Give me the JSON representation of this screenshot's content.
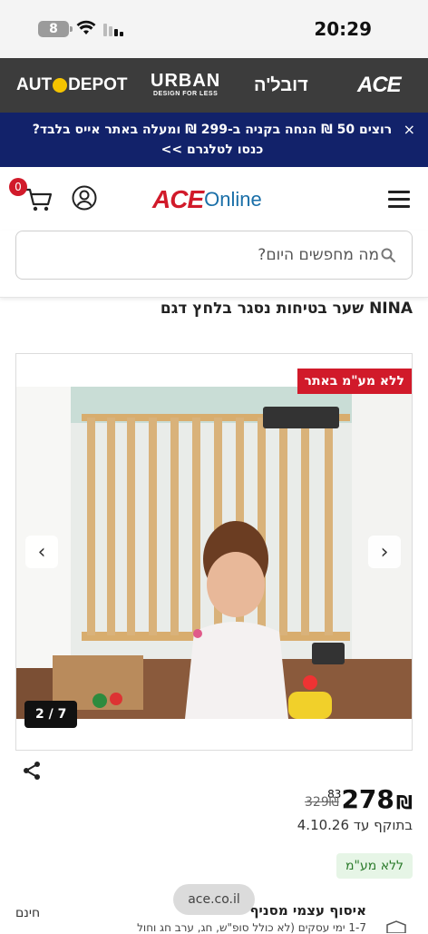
{
  "status_bar": {
    "time": "20:29",
    "battery": "8",
    "wifi_icon": "wifi-icon",
    "signal_icon": "signal-icon"
  },
  "brands": {
    "autodepot_left": "AUT",
    "autodepot_right": "DEPOT",
    "urban_main": "URBAN",
    "urban_sub": "DESIGN FOR LESS",
    "dubla": "דובל'ה",
    "ace": "ACE"
  },
  "promo": {
    "text": "רוצים 50 ₪ הנחה בקניה ב-299 ₪ ומעלה באתר אייס בלבד? כנסו לטלגרם >>",
    "close": "×"
  },
  "header": {
    "cart_count": "0",
    "logo_ace": "ACE",
    "logo_online": "Online"
  },
  "search": {
    "placeholder": "מה מחפשים היום?"
  },
  "product": {
    "title": "NINA שער בטיחות נסגר בלחץ דגם",
    "badge": "ללא מע\"מ באתר",
    "image_counter": "2 / 7",
    "arrow_prev": "‹",
    "arrow_next": "›",
    "price_integer": "278",
    "price_decimal": "83",
    "currency": "₪",
    "old_price": "329₪",
    "valid_until": "בתוקף עד 4.10.26",
    "vat_chip": "ללא מע\"מ"
  },
  "shipping": {
    "pickup_title": "איסוף עצמי מסניף",
    "pickup_subtitle": "1-7 ימי עסקים (לא כולל סופ\"ש, חג, ערב חג וחול",
    "pickup_price": "חינם"
  },
  "url_pill": "ace.co.il",
  "colors": {
    "brand_red": "#d11a2a",
    "promo_navy": "#12226a",
    "brand_strip": "#3c3c3c",
    "online_blue": "#1a6fa8"
  }
}
